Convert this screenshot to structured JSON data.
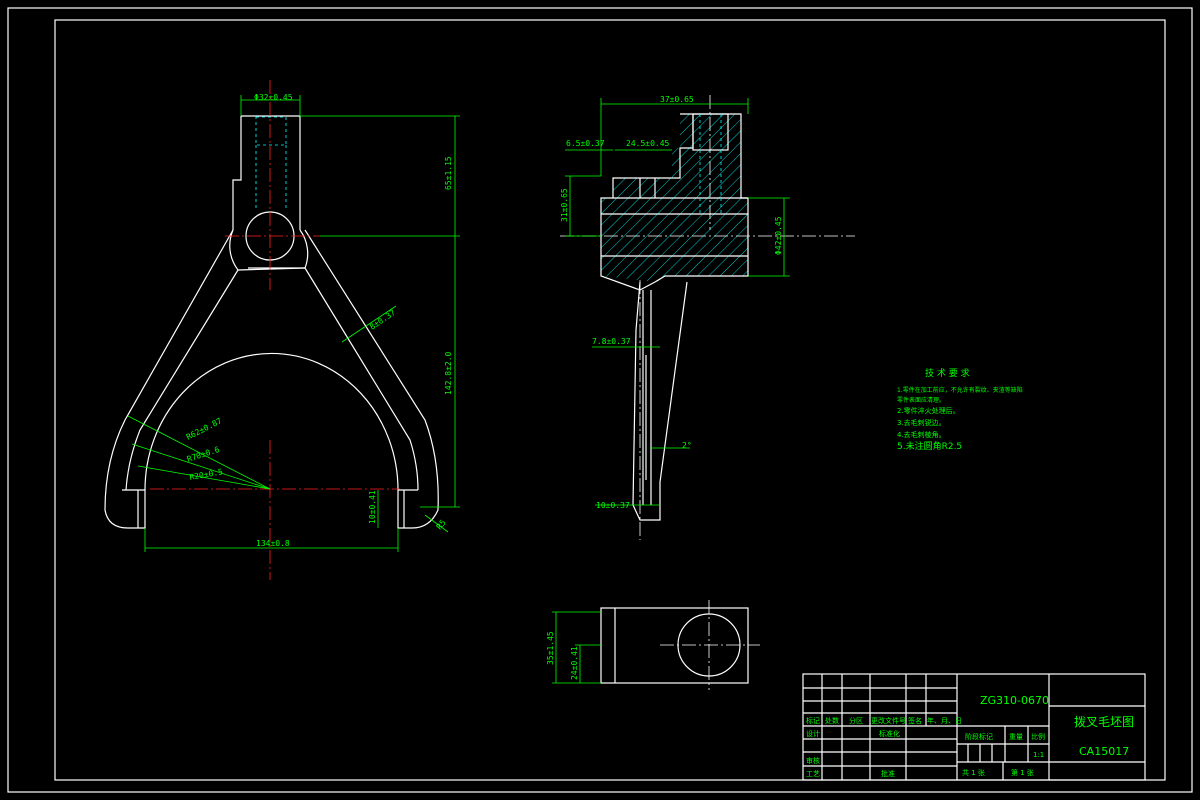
{
  "dims": {
    "top_width": "Φ32±0.45",
    "center_height_upper": "65±1.15",
    "center_height_lower": "142.8±2.0",
    "arm_thickness": "8±0.37",
    "r_outer": "R62±0.87",
    "r_mid": "R70±0.6",
    "r_inner": "R20±0.5",
    "bottom_width": "134±0.8",
    "foot_height": "10±0.41",
    "side_top_width": "37±0.65",
    "side_offset": "6.5±0.37",
    "side_slot": "24.5±0.45",
    "side_height": "31±0.65",
    "side_bore": "Φ42±0.45",
    "side_web": "7.8±0.37",
    "side_angle": "2°",
    "side_tip": "10±0.37",
    "bottom_view_outer": "35±1.45",
    "bottom_view_inner": "24±0.41",
    "small_r": "R5"
  },
  "tech": {
    "title": "技 术 要 求",
    "items": [
      "1.零件在加工前应，不允许有裂纹、夹渣等缺陷",
      "零件表面应清理。",
      "2.零件淬火处理后。",
      "3.去毛刺锐边。",
      "4.去毛刺棱角。",
      "5.未注圆角R2.5"
    ]
  },
  "title_block": {
    "drawing_no": "ZG310-0670",
    "name": "拨叉毛坯图",
    "code": "CA15017",
    "scale_label": "比例",
    "scale": "1:1",
    "weight_label": "重量",
    "stage_label": "阶段标记",
    "sheet_total": "共 1 张",
    "sheet_no": "第 1 张",
    "header_cells": [
      "标记",
      "处数",
      "分区",
      "更改文件号",
      "签名",
      "年、月、日"
    ],
    "design": "设计",
    "standard": "标准化",
    "check": "审核",
    "process": "工艺",
    "approve": "批准"
  }
}
